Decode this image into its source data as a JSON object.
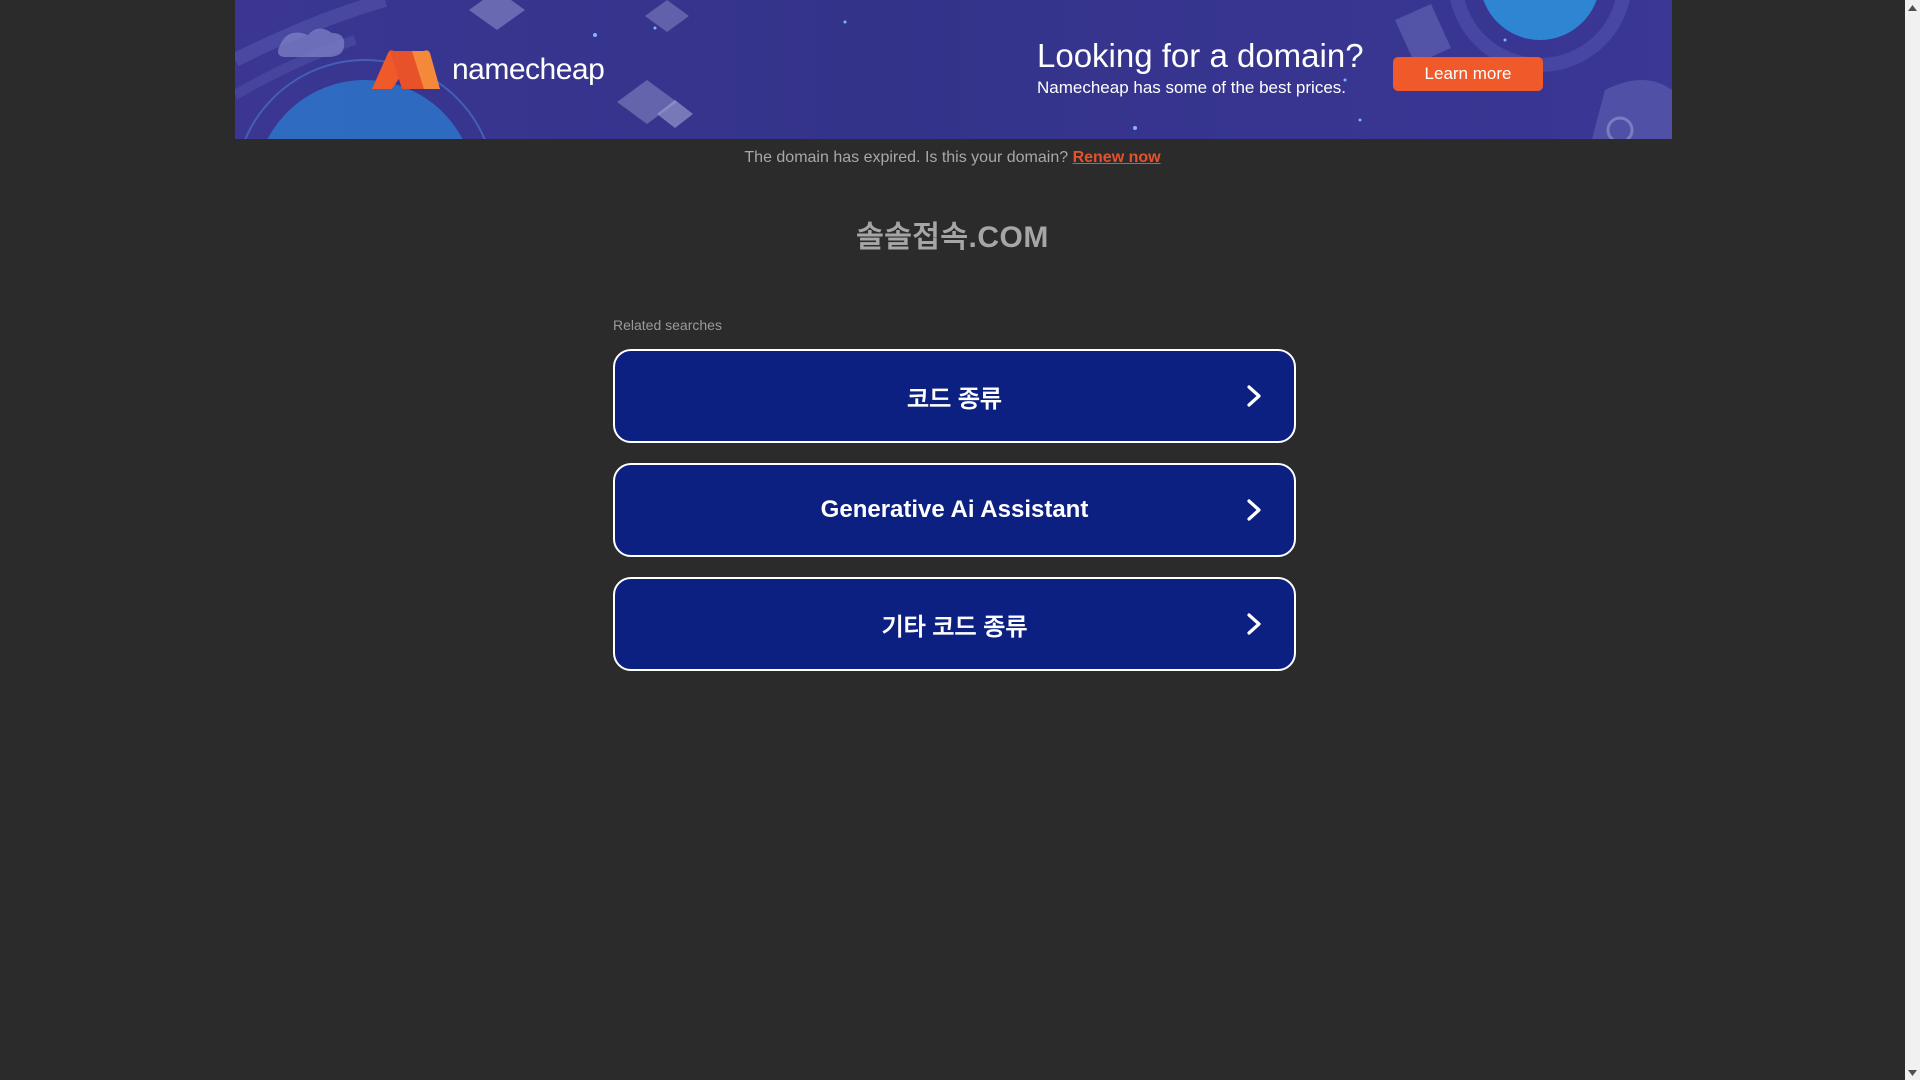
{
  "banner": {
    "logo_text": "namecheap",
    "promo_title": "Looking for a domain?",
    "promo_subtitle": "Namecheap has some of the best prices.",
    "learn_more_label": "Learn more"
  },
  "notice": {
    "text": "The domain has expired. Is this your domain?",
    "renew_label": "Renew now"
  },
  "domain": {
    "title": "솔솔접속.COM"
  },
  "related": {
    "label": "Related searches",
    "items": [
      {
        "label": "코드 종류"
      },
      {
        "label": "Generative Ai Assistant"
      },
      {
        "label": "기타 코드 종류"
      }
    ]
  },
  "colors": {
    "page_bg": "#2b2b2b",
    "banner_bg": "#3a3692",
    "accent_orange": "#f0592a",
    "result_bg": "#0b2080"
  },
  "icons": {
    "result_arrow": "chevron-right-icon",
    "scroll_up": "arrow-up-icon",
    "scroll_down": "arrow-down-icon"
  }
}
